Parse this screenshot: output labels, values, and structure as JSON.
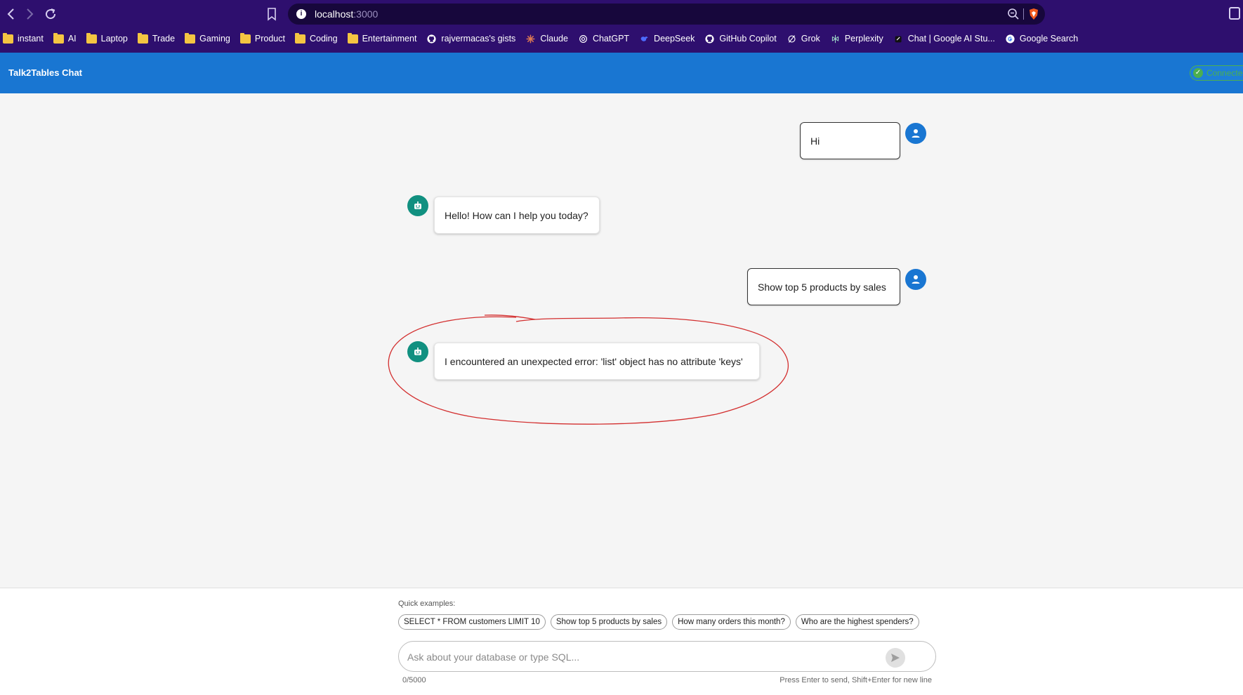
{
  "browser": {
    "address": {
      "host": "localhost",
      "port": ":3000"
    },
    "bookmarks": [
      {
        "label": "instant",
        "icon": "folder-icon"
      },
      {
        "label": "AI",
        "icon": "folder-icon"
      },
      {
        "label": "Laptop",
        "icon": "folder-icon"
      },
      {
        "label": "Trade",
        "icon": "folder-icon"
      },
      {
        "label": "Gaming",
        "icon": "folder-icon"
      },
      {
        "label": "Product",
        "icon": "folder-icon"
      },
      {
        "label": "Coding",
        "icon": "folder-icon"
      },
      {
        "label": "Entertainment",
        "icon": "folder-icon"
      },
      {
        "label": "rajvermacas's gists",
        "icon": "github-icon"
      },
      {
        "label": "Claude",
        "icon": "claude-icon"
      },
      {
        "label": "ChatGPT",
        "icon": "chatgpt-icon"
      },
      {
        "label": "DeepSeek",
        "icon": "deepseek-icon"
      },
      {
        "label": "GitHub Copilot",
        "icon": "github-icon"
      },
      {
        "label": "Grok",
        "icon": "grok-icon"
      },
      {
        "label": "Perplexity",
        "icon": "perplexity-icon"
      },
      {
        "label": "Chat | Google AI Stu...",
        "icon": "aistudio-icon"
      },
      {
        "label": "Google Search",
        "icon": "google-icon"
      }
    ]
  },
  "app": {
    "title": "Talk2Tables Chat",
    "status": "Connected"
  },
  "messages": [
    {
      "role": "user",
      "text": "Hi"
    },
    {
      "role": "bot",
      "text": "Hello! How can I help you today?"
    },
    {
      "role": "user",
      "text": "Show top 5 products by sales"
    },
    {
      "role": "bot",
      "text": "I encountered an unexpected error: 'list' object has no attribute 'keys'"
    }
  ],
  "input": {
    "quick_label": "Quick examples:",
    "quick_examples": [
      "SELECT * FROM customers LIMIT 10",
      "Show top 5 products by sales",
      "How many orders this month?",
      "Who are the highest spenders?"
    ],
    "placeholder": "Ask about your database or type SQL...",
    "value": "",
    "char_count": "0/5000",
    "hint": "Press Enter to send, Shift+Enter for new line"
  },
  "colors": {
    "browser_chrome": "#2e0f6e",
    "app_header": "#1976d2",
    "user_avatar": "#1976d2",
    "bot_avatar": "#119080",
    "status_green": "#4caf50",
    "annotation_red": "#d32f2f"
  }
}
